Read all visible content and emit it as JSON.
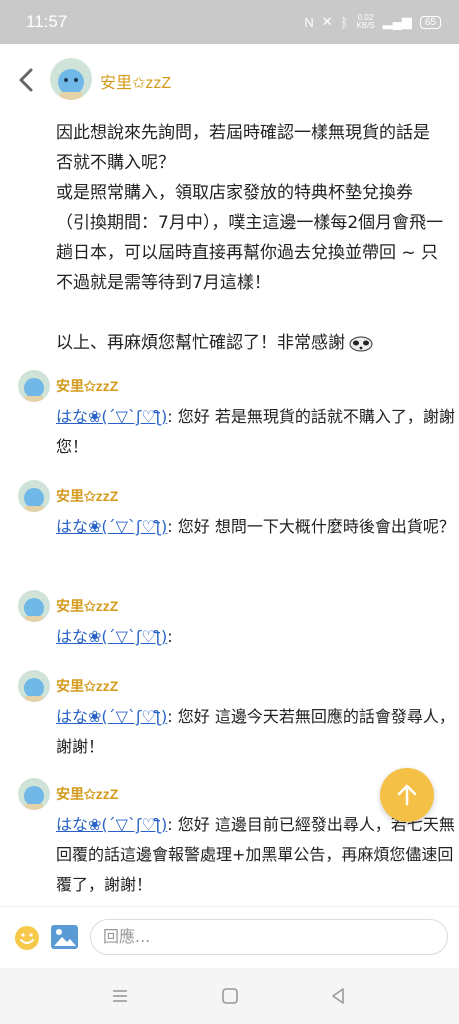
{
  "status_bar": {
    "time": "11:57",
    "net_speed_value": "0.02",
    "net_speed_unit": "KB/S",
    "battery": "65"
  },
  "header": {
    "title": "安里✩zzZ"
  },
  "first_message": {
    "lines_a": [
      "因此想說來先詢問，若屆時確認一樣無現貨的話是否就不購入呢？",
      "或是照常購入，領取店家發放的特典杯墊兌換券（引換期間：7月中），噗主這邊一樣每2個月會飛一趟日本，可以屆時直接再幫你過去兌換並帶回 ~ 只不過就是需等待到7月這樣！"
    ],
    "closing": "以上、再麻煩您幫忙確認了！非常感謝"
  },
  "comments": [
    {
      "author": "安里✩zzZ",
      "mention": "はな❀(´▽`ʃ♡ƪ)",
      "text": ": 您好 若是無現貨的話就不購入了，謝謝您！"
    },
    {
      "author": "安里✩zzZ",
      "mention": "はな❀(´▽`ʃ♡ƪ)",
      "text": ": 您好 想問一下大概什麼時後會出貨呢？"
    },
    {
      "author": "安里✩zzZ",
      "mention": "はな❀(´▽`ʃ♡ƪ)",
      "text": ":"
    },
    {
      "author": "安里✩zzZ",
      "mention": "はな❀(´▽`ʃ♡ƪ)",
      "text": ": 您好 這邊今天若無回應的話會發尋人，謝謝！"
    },
    {
      "author": "安里✩zzZ",
      "mention": "はな❀(´▽`ʃ♡ƪ)",
      "text": ": 您好 這邊目前已經發出尋人，若七天無回覆的話這邊會報警處理+加黑單公告，再麻煩您儘速回覆了，謝謝！"
    }
  ],
  "reply": {
    "placeholder": "回應..."
  },
  "icons": {
    "back": "chevron-left-icon",
    "fab": "arrow-up-icon",
    "emoji": "smiley-icon",
    "image": "image-icon",
    "nav_menu": "menu-icon",
    "nav_home": "square-home-icon",
    "nav_back": "triangle-back-icon"
  },
  "colors": {
    "accent": "#f4c146",
    "name": "#d49a1c",
    "link": "#2a63c7"
  }
}
